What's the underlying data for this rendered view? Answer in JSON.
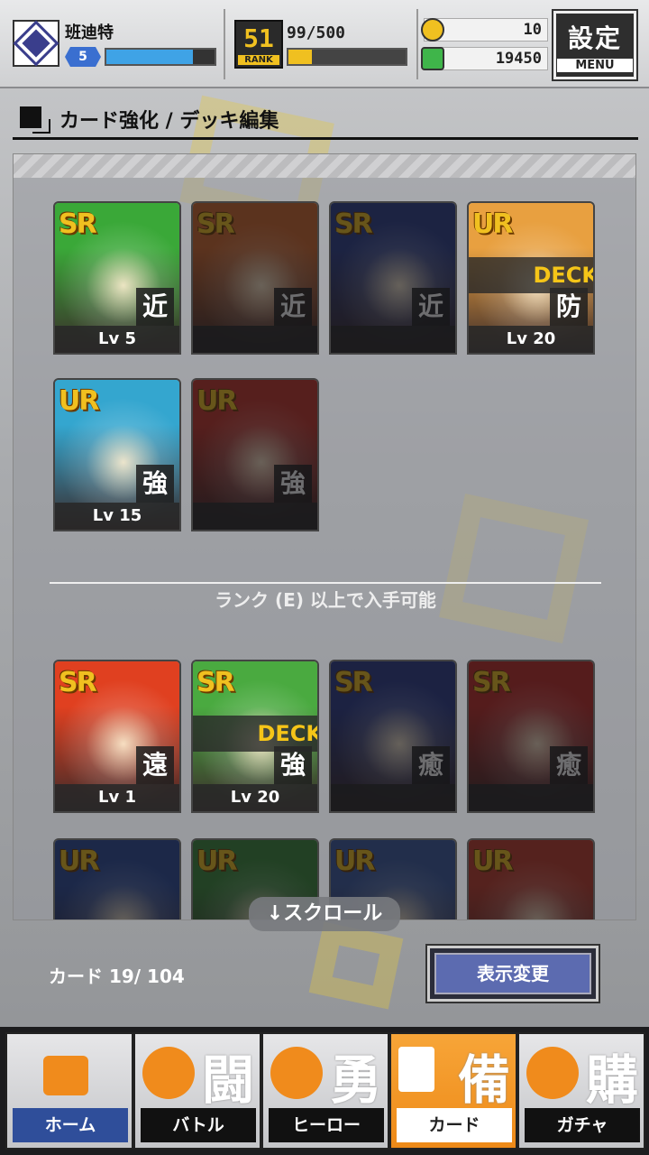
{
  "player": {
    "name": "班迪特",
    "level": "5",
    "exp_fraction": 0.8
  },
  "rank": {
    "number": "51",
    "label": "RANK",
    "stamina_text": "99/500",
    "stamina_fraction": 0.2
  },
  "currency": {
    "coins": "10",
    "gems": "19450"
  },
  "menu": {
    "kanji": "設定",
    "label": "MENU"
  },
  "section": {
    "title": "カード強化 / デッキ編集"
  },
  "cards_owned": [
    {
      "rarity": "SR",
      "type": "近",
      "level": "Lv 5",
      "deck": "",
      "dim": false,
      "art": "#3aa838"
    },
    {
      "rarity": "SR",
      "type": "近",
      "level": "",
      "deck": "",
      "dim": true,
      "art": "#d0662a"
    },
    {
      "rarity": "SR",
      "type": "近",
      "level": "",
      "deck": "",
      "dim": true,
      "art": "#2c3e8a"
    },
    {
      "rarity": "UR",
      "type": "防",
      "level": "Lv 20",
      "deck": "DECK",
      "dim": false,
      "art": "#e8a040"
    },
    {
      "rarity": "UR",
      "type": "強",
      "level": "Lv 15",
      "deck": "",
      "dim": false,
      "art": "#34a6cf"
    },
    {
      "rarity": "UR",
      "type": "強",
      "level": "",
      "deck": "",
      "dim": true,
      "art": "#c23228"
    }
  ],
  "rank_note": "ランク (E) 以上で入手可能",
  "cards_rank": [
    {
      "rarity": "SR",
      "type": "遠",
      "level": "Lv 1",
      "deck": "",
      "dim": false,
      "art": "#e04020"
    },
    {
      "rarity": "SR",
      "type": "強",
      "level": "Lv 20",
      "deck": "DECK",
      "dim": false,
      "art": "#4aaa40"
    },
    {
      "rarity": "SR",
      "type": "癒",
      "level": "",
      "deck": "",
      "dim": true,
      "art": "#2a3a8a"
    },
    {
      "rarity": "SR",
      "type": "癒",
      "level": "",
      "deck": "",
      "dim": true,
      "art": "#c02a26"
    },
    {
      "rarity": "UR",
      "type": "",
      "level": "",
      "deck": "",
      "dim": true,
      "art": "#2a4a9a"
    },
    {
      "rarity": "UR",
      "type": "",
      "level": "",
      "deck": "",
      "dim": true,
      "art": "#3a8a3a"
    },
    {
      "rarity": "UR",
      "type": "",
      "level": "",
      "deck": "",
      "dim": true,
      "art": "#3a5aa0"
    },
    {
      "rarity": "UR",
      "type": "",
      "level": "",
      "deck": "",
      "dim": true,
      "art": "#c03a2a"
    }
  ],
  "scroll_hint": "↓スクロール",
  "card_count": "カード 19/ 104",
  "display_button": "表示変更",
  "nav": [
    {
      "kanji": "",
      "label": "ホーム",
      "icon": "return-arrow-icon"
    },
    {
      "kanji": "闘",
      "label": "バトル",
      "icon": "gamepad-icon"
    },
    {
      "kanji": "勇",
      "label": "ヒーロー",
      "icon": "hero-icon"
    },
    {
      "kanji": "備",
      "label": "カード",
      "icon": "card-deck-icon"
    },
    {
      "kanji": "購",
      "label": "ガチャ",
      "icon": "gacha-icon"
    }
  ],
  "colors": {
    "accent": "#f08b1c",
    "exp": "#3fa3e6",
    "stamina": "#f0c020",
    "deck": "#f5c518"
  }
}
